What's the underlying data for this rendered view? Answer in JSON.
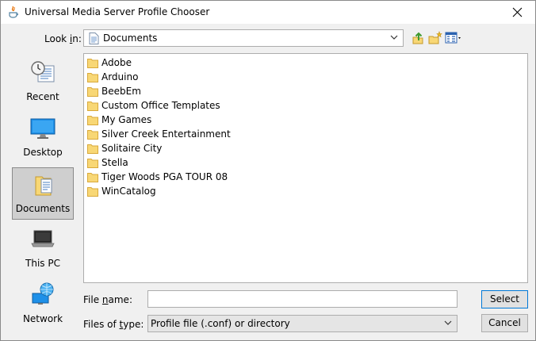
{
  "window": {
    "title": "Universal Media Server Profile Chooser"
  },
  "look_in": {
    "label_pre": "Look ",
    "label_mnemonic": "i",
    "label_post": "n:",
    "value": "Documents"
  },
  "toolbar": {
    "icons": [
      "up-one-level-icon",
      "create-new-folder-icon",
      "view-menu-icon"
    ]
  },
  "places": [
    {
      "label": "Recent",
      "icon": "recent-icon",
      "selected": false
    },
    {
      "label": "Desktop",
      "icon": "desktop-icon",
      "selected": false
    },
    {
      "label": "Documents",
      "icon": "documents-icon",
      "selected": true
    },
    {
      "label": "This PC",
      "icon": "this-pc-icon",
      "selected": false
    },
    {
      "label": "Network",
      "icon": "network-icon",
      "selected": false
    }
  ],
  "files": [
    "Adobe",
    "Arduino",
    "BeebEm",
    "Custom Office Templates",
    "My Games",
    "Silver Creek Entertainment",
    "Solitaire City",
    "Stella",
    "Tiger Woods PGA TOUR 08",
    "WinCatalog"
  ],
  "file_name": {
    "label_pre": "File ",
    "label_mnemonic": "n",
    "label_post": "ame:",
    "value": ""
  },
  "file_type": {
    "label_pre": "Files of ",
    "label_mnemonic": "t",
    "label_post": "ype:",
    "value": "Profile file (.conf) or directory"
  },
  "buttons": {
    "select": "Select",
    "cancel": "Cancel"
  },
  "colors": {
    "folder": "#f8d775",
    "folder_edge": "#d9a93a",
    "accent": "#0078d7"
  }
}
